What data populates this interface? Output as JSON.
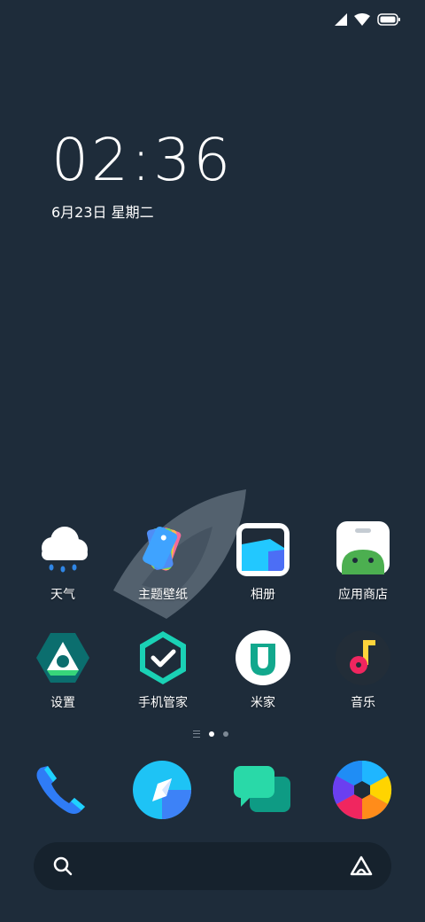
{
  "status_bar": {
    "signal_icon": "cellular-signal-icon",
    "wifi_icon": "wifi-icon",
    "battery_icon": "battery-icon"
  },
  "clock": {
    "time": "02:36",
    "date": "6月23日 星期二"
  },
  "apps_row1": [
    {
      "label": "天气",
      "icon": "weather-icon"
    },
    {
      "label": "主题壁纸",
      "icon": "themes-icon"
    },
    {
      "label": "相册",
      "icon": "gallery-icon"
    },
    {
      "label": "应用商店",
      "icon": "app-store-icon"
    }
  ],
  "apps_row2": [
    {
      "label": "设置",
      "icon": "settings-icon"
    },
    {
      "label": "手机管家",
      "icon": "security-icon"
    },
    {
      "label": "米家",
      "icon": "mi-home-icon"
    },
    {
      "label": "音乐",
      "icon": "music-icon"
    }
  ],
  "page_indicator": {
    "pages": 2,
    "current": 1
  },
  "dock": [
    {
      "icon": "phone-icon"
    },
    {
      "icon": "browser-icon"
    },
    {
      "icon": "messages-icon"
    },
    {
      "icon": "camera-icon"
    }
  ],
  "search_bar": {
    "search_icon": "search-icon",
    "assistant_icon": "assistant-icon"
  },
  "colors": {
    "background": "#1e2c3a",
    "search_bar": "#16222d",
    "text": "#ffffff"
  }
}
